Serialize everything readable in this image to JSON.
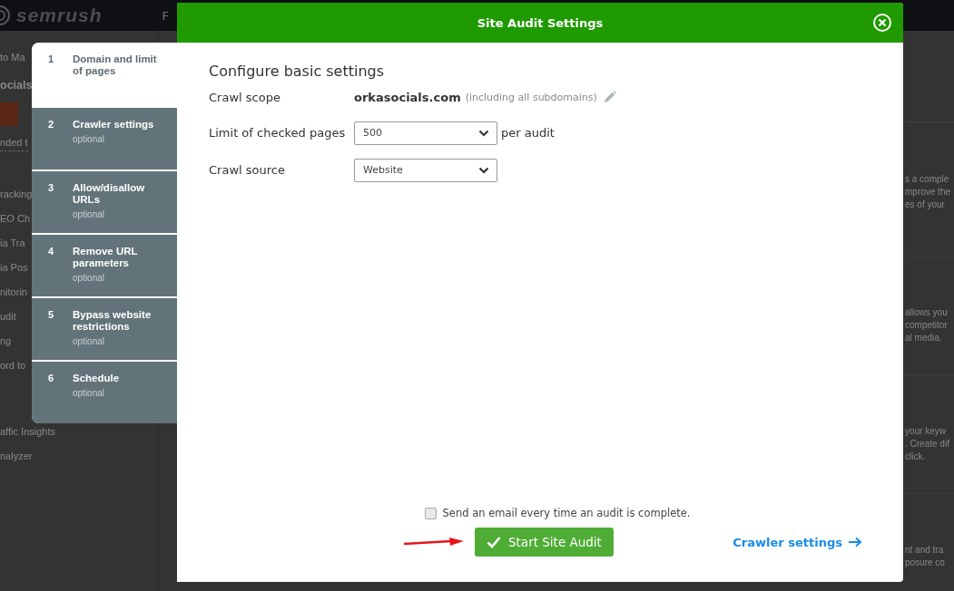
{
  "top_bar": {
    "logo": "semrush",
    "nav_fragment": "F"
  },
  "background_sidebar": {
    "items": [
      {
        "kind": "link",
        "text": "to Ma"
      },
      {
        "kind": "project",
        "text": "ocials"
      },
      {
        "kind": "bar"
      },
      {
        "kind": "dashed",
        "text": "nded t"
      },
      {
        "kind": "gap"
      },
      {
        "kind": "link",
        "text": "racking"
      },
      {
        "kind": "link",
        "text": "EO Ch"
      },
      {
        "kind": "link",
        "text": "ia Tra"
      },
      {
        "kind": "link",
        "text": "ia Pos"
      },
      {
        "kind": "link",
        "text": "nitorin"
      },
      {
        "kind": "link",
        "text": "udit"
      },
      {
        "kind": "link",
        "text": "ng"
      },
      {
        "kind": "link",
        "text": "ord to"
      },
      {
        "kind": "gap"
      },
      {
        "kind": "link",
        "text": "affic Insights"
      },
      {
        "kind": "link",
        "text": "nalyzer"
      }
    ]
  },
  "background_cards": [
    {
      "lines": [
        "s a comple",
        "mprove the",
        "es of your"
      ]
    },
    {
      "lines": [
        "allows you",
        "competitor",
        "al media."
      ]
    },
    {
      "lines": [
        "your keyw",
        ". Create dif",
        "click."
      ]
    },
    {
      "lines": [
        "nt and tra",
        "posure co"
      ]
    }
  ],
  "dialog": {
    "title": "Site Audit Settings",
    "steps": [
      {
        "number": "1",
        "title": "Domain and limit of pages",
        "selected": true
      },
      {
        "number": "2",
        "title": "Crawler settings",
        "subtitle": "optional",
        "selected": false
      },
      {
        "number": "3",
        "title": "Allow/disallow URLs",
        "subtitle": "optional",
        "selected": false
      },
      {
        "number": "4",
        "title": "Remove URL parameters",
        "subtitle": "optional",
        "selected": false
      },
      {
        "number": "5",
        "title": "Bypass website restrictions",
        "subtitle": "optional",
        "selected": false
      },
      {
        "number": "6",
        "title": "Schedule",
        "subtitle": "optional",
        "selected": false
      }
    ],
    "heading": "Configure basic settings",
    "fields": [
      {
        "kind": "scope",
        "label": "Crawl scope",
        "value": "orkasocials.com",
        "note": "(including all subdomains)"
      },
      {
        "kind": "select",
        "label": "Limit of checked pages",
        "value": "500",
        "suffix": "per audit"
      },
      {
        "kind": "select",
        "label": "Crawl source",
        "value": "Website"
      }
    ],
    "email_checkbox": {
      "label": "Send an email every time an audit is complete.",
      "checked": false
    },
    "start_button": "Start Site Audit",
    "next_link": "Crawler settings"
  }
}
